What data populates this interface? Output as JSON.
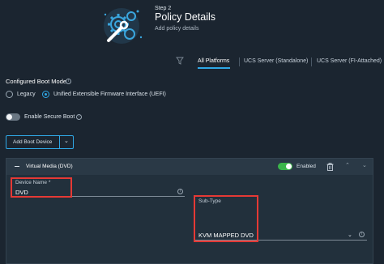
{
  "header": {
    "step": "Step 2",
    "title": "Policy Details",
    "subtitle": "Add policy details",
    "icon": "gears-wrench-icon"
  },
  "tabs": [
    {
      "label": "All Platforms",
      "active": true
    },
    {
      "label": "UCS Server (Standalone)",
      "active": false
    },
    {
      "label": "UCS Server (FI-Attached)",
      "active": false
    }
  ],
  "boot_mode": {
    "label": "Configured Boot Mode",
    "options": [
      {
        "label": "Legacy",
        "selected": false
      },
      {
        "label": "Unified Extensible Firmware Interface (UEFI)",
        "selected": true
      }
    ]
  },
  "secure_boot": {
    "label": "Enable Secure Boot",
    "enabled": false
  },
  "add_boot_device": {
    "label": "Add Boot Device"
  },
  "device_panel": {
    "title": "Virtual Media (DVD)",
    "enabled_label": "Enabled",
    "enabled": true,
    "device_name": {
      "label": "Device Name *",
      "value": "DVD"
    },
    "sub_type": {
      "label": "Sub-Type",
      "value": "KVM MAPPED DVD"
    }
  },
  "colors": {
    "background": "#1b2530",
    "accent": "#2fa8e6",
    "toggle_on": "#3bb54a",
    "highlight_box": "#e53935"
  }
}
